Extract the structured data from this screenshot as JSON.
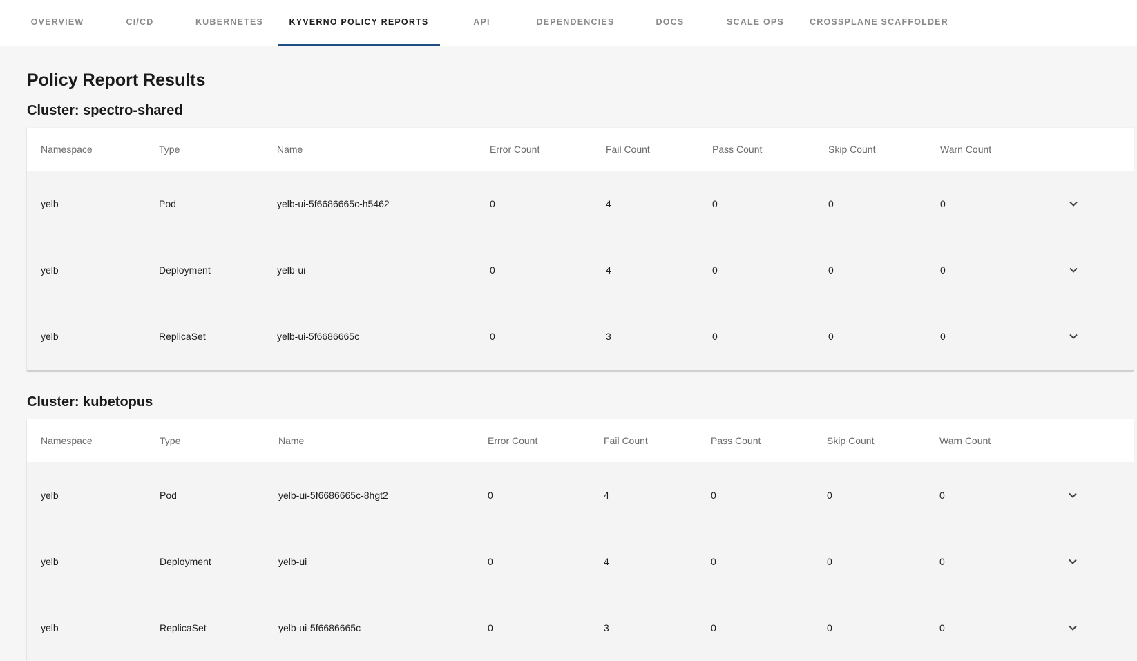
{
  "tabs": [
    {
      "label": "OVERVIEW"
    },
    {
      "label": "CI/CD"
    },
    {
      "label": "KUBERNETES"
    },
    {
      "label": "KYVERNO POLICY REPORTS"
    },
    {
      "label": "API"
    },
    {
      "label": "DEPENDENCIES"
    },
    {
      "label": "DOCS"
    },
    {
      "label": "SCALE OPS"
    },
    {
      "label": "CROSSPLANE SCAFFOLDER"
    }
  ],
  "active_tab": "KYVERNO POLICY REPORTS",
  "page_title": "Policy Report Results",
  "columns": [
    "Namespace",
    "Type",
    "Name",
    "Error Count",
    "Fail Count",
    "Pass Count",
    "Skip Count",
    "Warn Count"
  ],
  "clusters": [
    {
      "heading": "Cluster: spectro-shared",
      "rows": [
        {
          "namespace": "yelb",
          "type": "Pod",
          "name": "yelb-ui-5f6686665c-h5462",
          "error": "0",
          "fail": "4",
          "pass": "0",
          "skip": "0",
          "warn": "0"
        },
        {
          "namespace": "yelb",
          "type": "Deployment",
          "name": "yelb-ui",
          "error": "0",
          "fail": "4",
          "pass": "0",
          "skip": "0",
          "warn": "0"
        },
        {
          "namespace": "yelb",
          "type": "ReplicaSet",
          "name": "yelb-ui-5f6686665c",
          "error": "0",
          "fail": "3",
          "pass": "0",
          "skip": "0",
          "warn": "0"
        }
      ]
    },
    {
      "heading": "Cluster: kubetopus",
      "rows": [
        {
          "namespace": "yelb",
          "type": "Pod",
          "name": "yelb-ui-5f6686665c-8hgt2",
          "error": "0",
          "fail": "4",
          "pass": "0",
          "skip": "0",
          "warn": "0"
        },
        {
          "namespace": "yelb",
          "type": "Deployment",
          "name": "yelb-ui",
          "error": "0",
          "fail": "4",
          "pass": "0",
          "skip": "0",
          "warn": "0"
        },
        {
          "namespace": "yelb",
          "type": "ReplicaSet",
          "name": "yelb-ui-5f6686665c",
          "error": "0",
          "fail": "3",
          "pass": "0",
          "skip": "0",
          "warn": "0"
        }
      ]
    }
  ],
  "row_expand_icon": "chevron-down-icon",
  "colors": {
    "active_tab_underline": "#1f4f82",
    "page_background": "#f6f6f6"
  }
}
